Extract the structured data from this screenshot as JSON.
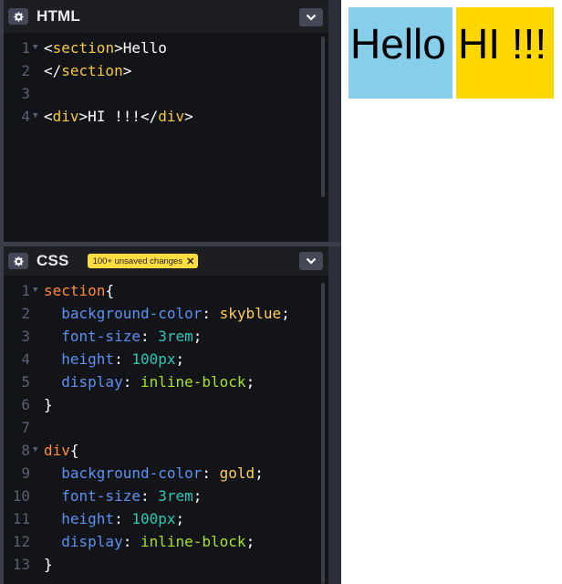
{
  "html_panel": {
    "title": "HTML",
    "lines": [
      {
        "n": "1",
        "fold": true,
        "parts": [
          [
            "punc",
            "<"
          ],
          [
            "tag",
            "section"
          ],
          [
            "punc",
            ">Hello"
          ]
        ]
      },
      {
        "n": "2",
        "fold": false,
        "parts": [
          [
            "punc",
            "</"
          ],
          [
            "tag",
            "section"
          ],
          [
            "punc",
            ">"
          ]
        ]
      },
      {
        "n": "3",
        "fold": false,
        "parts": []
      },
      {
        "n": "4",
        "fold": true,
        "parts": [
          [
            "punc",
            "<"
          ],
          [
            "tag",
            "div"
          ],
          [
            "punc",
            ">HI !!!</"
          ],
          [
            "tag",
            "div"
          ],
          [
            "punc",
            ">"
          ]
        ]
      }
    ]
  },
  "css_panel": {
    "title": "CSS",
    "badge": "100+ unsaved changes",
    "badge_close": "✕",
    "lines": [
      {
        "n": "1",
        "fold": true,
        "parts": [
          [
            "sel",
            "section"
          ],
          [
            "punc",
            "{"
          ]
        ]
      },
      {
        "n": "2",
        "fold": false,
        "parts": [
          [
            "punc",
            "  "
          ],
          [
            "prop",
            "background-color"
          ],
          [
            "punc",
            ": "
          ],
          [
            "val",
            "skyblue"
          ],
          [
            "punc",
            ";"
          ]
        ]
      },
      {
        "n": "3",
        "fold": false,
        "parts": [
          [
            "punc",
            "  "
          ],
          [
            "prop",
            "font-size"
          ],
          [
            "punc",
            ": "
          ],
          [
            "num",
            "3rem"
          ],
          [
            "punc",
            ";"
          ]
        ]
      },
      {
        "n": "4",
        "fold": false,
        "parts": [
          [
            "punc",
            "  "
          ],
          [
            "prop",
            "height"
          ],
          [
            "punc",
            ": "
          ],
          [
            "num",
            "100px"
          ],
          [
            "punc",
            ";"
          ]
        ]
      },
      {
        "n": "5",
        "fold": false,
        "parts": [
          [
            "punc",
            "  "
          ],
          [
            "prop",
            "display"
          ],
          [
            "punc",
            ": "
          ],
          [
            "kw",
            "inline-block"
          ],
          [
            "punc",
            ";"
          ]
        ]
      },
      {
        "n": "6",
        "fold": false,
        "parts": [
          [
            "punc",
            "}"
          ]
        ]
      },
      {
        "n": "7",
        "fold": false,
        "parts": []
      },
      {
        "n": "8",
        "fold": true,
        "parts": [
          [
            "sel",
            "div"
          ],
          [
            "punc",
            "{"
          ]
        ]
      },
      {
        "n": "9",
        "fold": false,
        "parts": [
          [
            "punc",
            "  "
          ],
          [
            "prop",
            "background-color"
          ],
          [
            "punc",
            ": "
          ],
          [
            "val",
            "gold"
          ],
          [
            "punc",
            ";"
          ]
        ]
      },
      {
        "n": "10",
        "fold": false,
        "parts": [
          [
            "punc",
            "  "
          ],
          [
            "prop",
            "font-size"
          ],
          [
            "punc",
            ": "
          ],
          [
            "num",
            "3rem"
          ],
          [
            "punc",
            ";"
          ]
        ]
      },
      {
        "n": "11",
        "fold": false,
        "parts": [
          [
            "punc",
            "  "
          ],
          [
            "prop",
            "height"
          ],
          [
            "punc",
            ": "
          ],
          [
            "num",
            "100px"
          ],
          [
            "punc",
            ";"
          ]
        ]
      },
      {
        "n": "12",
        "fold": false,
        "parts": [
          [
            "punc",
            "  "
          ],
          [
            "prop",
            "display"
          ],
          [
            "punc",
            ": "
          ],
          [
            "kw",
            "inline-block"
          ],
          [
            "punc",
            ";"
          ]
        ]
      },
      {
        "n": "13",
        "fold": false,
        "parts": [
          [
            "punc",
            "}"
          ]
        ]
      }
    ]
  },
  "preview": {
    "section_text": "Hello",
    "div_text": "HI !!!",
    "section_color": "#87ceeb",
    "div_color": "#ffd700"
  },
  "icons": {
    "settings": "gear-icon",
    "collapse": "chevron-down-icon"
  }
}
